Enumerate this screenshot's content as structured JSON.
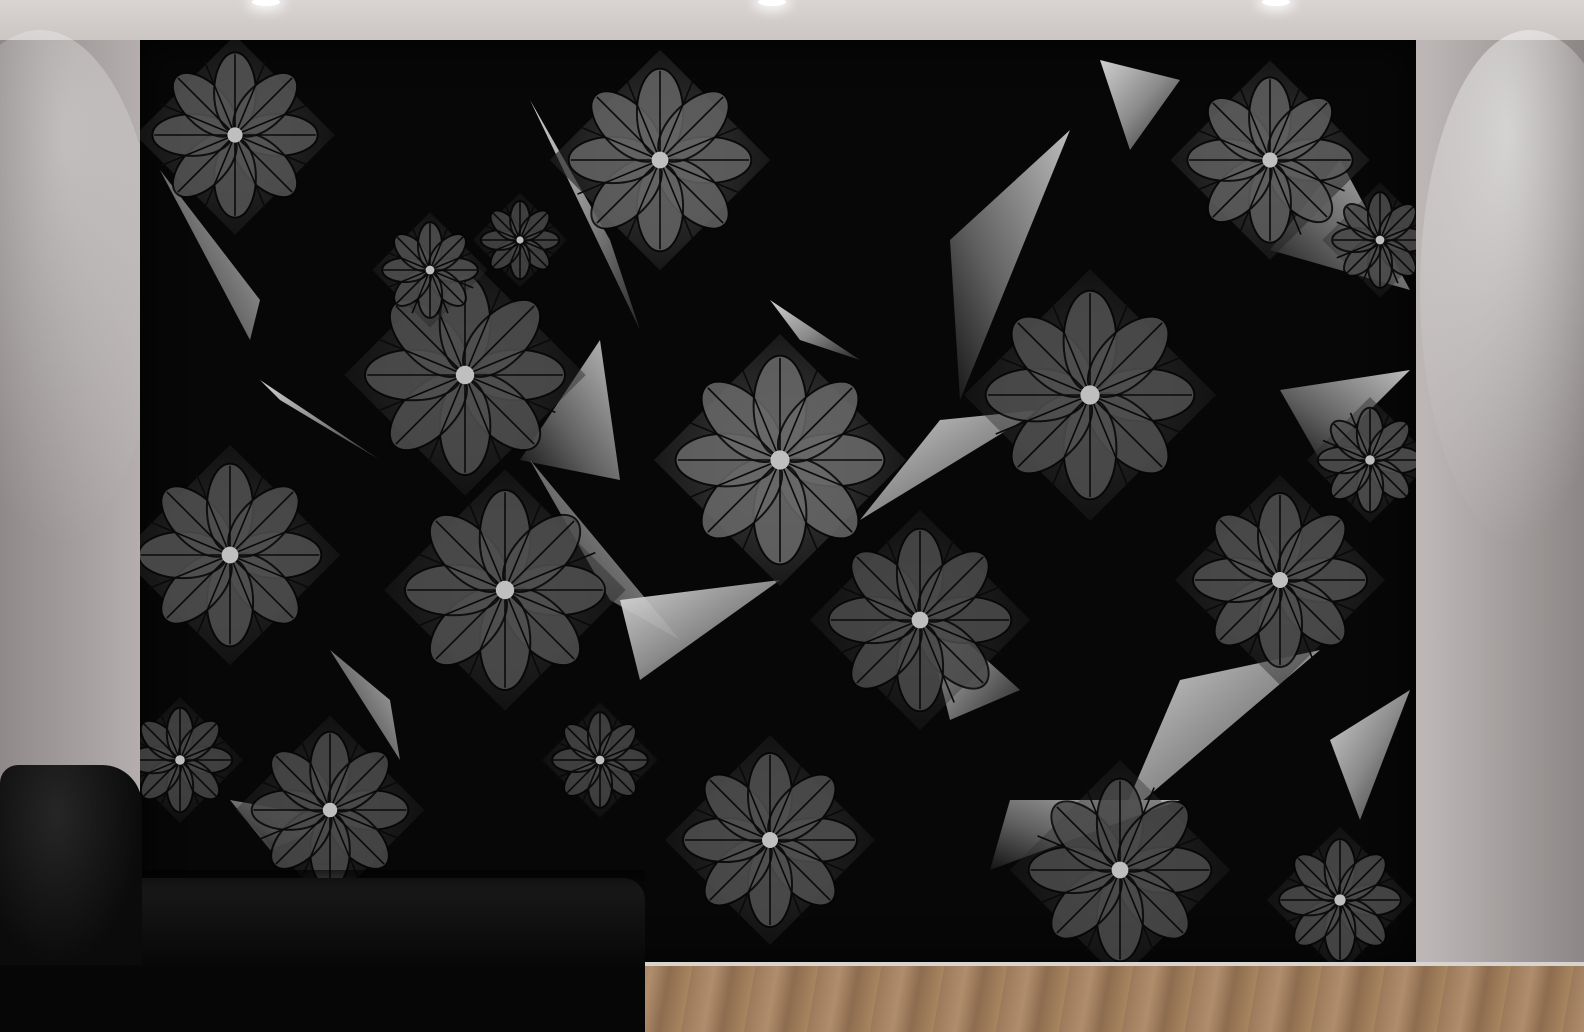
{
  "scene": {
    "description_visible_text": "",
    "colors": {
      "wall": "#c9c4c3",
      "mural_bg": "#070707",
      "petal_dark": "#1f1f1f",
      "petal_mid": "#4a4a4a",
      "facet_light": "#d8d8d8",
      "facet_mid": "#8a8a8a",
      "floor": "#a3805e",
      "sofa": "#101010"
    },
    "icons": [
      "spotlight-icon",
      "flower-medallion-icon"
    ]
  }
}
